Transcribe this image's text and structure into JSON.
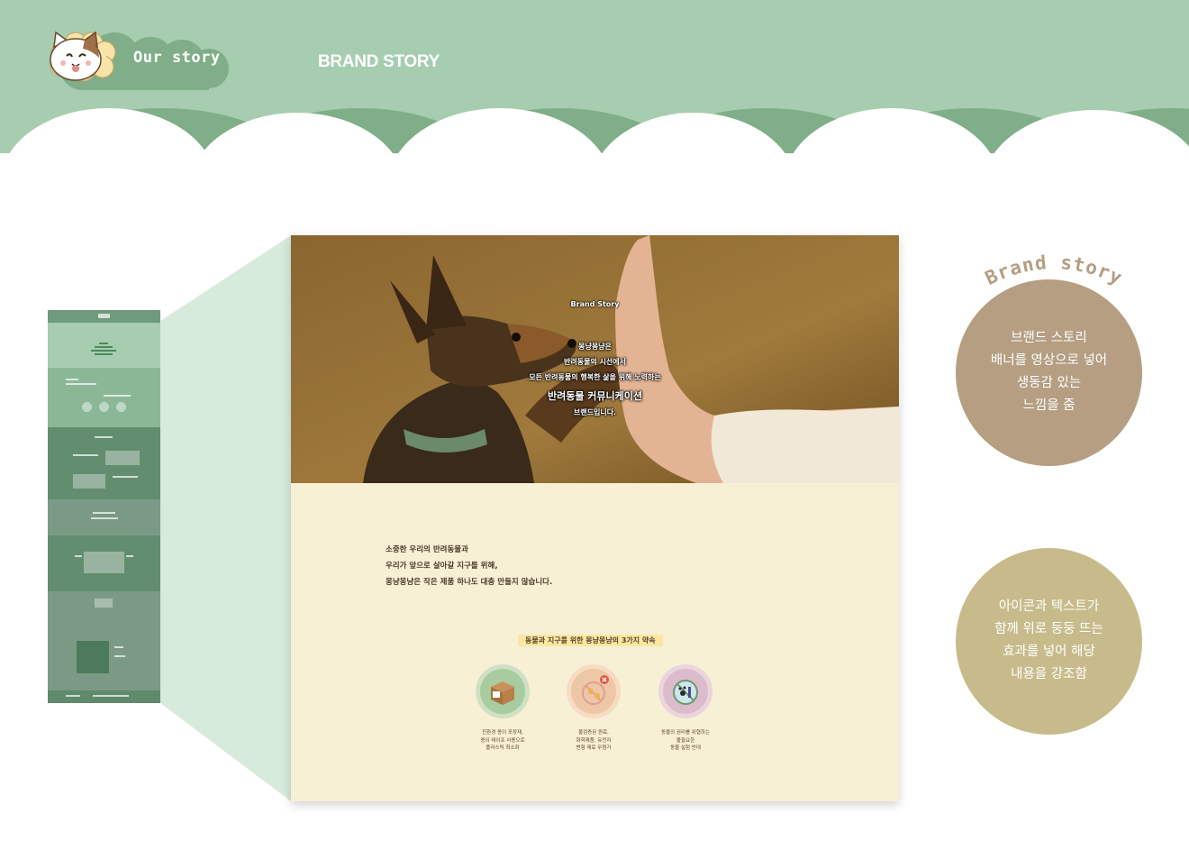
{
  "header": {
    "logo_text": "Our story",
    "section_title": "BRAND STORY"
  },
  "colors": {
    "header_green": "#a6cdaf",
    "dark_green": "#7fae88",
    "cream": "#f8f0d4",
    "tan_circle": "#b59e82",
    "khaki_circle": "#c8bb8b"
  },
  "mockup": {
    "hero": {
      "kicker": "Brand Story",
      "lines": [
        "몽냥몽냥은",
        "반려동물의 시선에서",
        "모든 반려동물의 행복한 삶을 위해 노력하는",
        "반려동물 커뮤니케이션",
        "브랜드입니다."
      ]
    },
    "intro_lines": [
      "소중한 우리의 반려동물과",
      "우리가 앞으로 살아갈 지구를 위해,",
      "몽냥몽냥은 작은 제품 하나도 대충 만들지 않습니다."
    ],
    "promise_title": "동물과 지구를 위한 몽냥몽냥의 3가지 약속",
    "promises": [
      {
        "icon": "box-icon",
        "lines": [
          "친환경 종이 포장재,",
          "종이 테이프 사용으로",
          "플라스틱 최소화"
        ]
      },
      {
        "icon": "no-chemical-icon",
        "lines": [
          "불검증된 원료,",
          "화학제품, 유전자",
          "변형 재료 무첨가"
        ]
      },
      {
        "icon": "no-animal-testing-icon",
        "lines": [
          "동물의 권리를 위협하는",
          "불필요한",
          "동물 실험 반대"
        ]
      }
    ]
  },
  "side_notes": {
    "arc_title": "Brand story",
    "note1": [
      "브랜드 스토리",
      "배너를 영상으로 넣어",
      "생동감 있는",
      "느낌을 줌"
    ],
    "note2": [
      "아이콘과 텍스트가",
      "함께 위로 둥둥 뜨는",
      "효과를 넣어 해당",
      "내용을 강조함"
    ]
  }
}
